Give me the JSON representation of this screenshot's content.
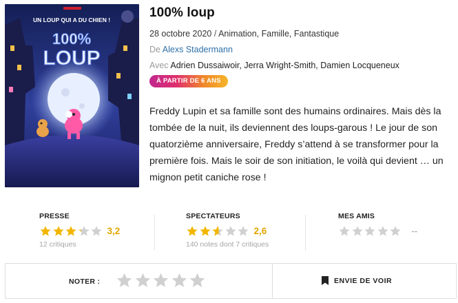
{
  "movie": {
    "title": "100% loup",
    "release_date": "28 octobre 2020",
    "separator": " / ",
    "genres": "Animation, Famille, Fantastique",
    "director_label": "De ",
    "director": "Alexs Stadermann",
    "cast_label": "Avec ",
    "cast": "Adrien Dussaiwoir, Jerra Wright-Smith, Damien Locqueneux",
    "age_badge": "À PARTIR DE 6 ANS",
    "synopsis": "Freddy Lupin et sa famille sont des humains ordinaires. Mais dès la tombée de la nuit, ils deviennent des loups-garous ! Le jour de son quatorzième anniversaire, Freddy s’attend à se transformer pour la première fois. Mais le soir de son initiation, le voilà qui devient … un mignon petit caniche rose !"
  },
  "poster": {
    "tagline": "UN LOUP QUI A DU CHIEN !",
    "title_line1": "100%",
    "title_line2": "LOUP",
    "colors": {
      "sky_top": "#1b2a6b",
      "sky_bottom": "#3b4fb8",
      "moon": "#e8f0ff",
      "poodle": "#ff5aa8"
    }
  },
  "ratings": {
    "presse": {
      "label": "PRESSE",
      "score": 3.2,
      "score_text": "3,2",
      "sub": "12 critiques"
    },
    "spectateurs": {
      "label": "SPECTATEURS",
      "score": 2.6,
      "score_text": "2,6",
      "sub": "140 notes dont 7 critiques"
    },
    "amis": {
      "label": "MES AMIS",
      "score": 0,
      "score_text": "--"
    }
  },
  "actions": {
    "noter_label": "NOTER :",
    "envie_label": "ENVIE DE VOIR",
    "envie_icon": "bookmark-icon"
  },
  "colors": {
    "star_filled": "#f2b600",
    "star_empty": "#d0d0d0",
    "link": "#2d6fa8"
  }
}
